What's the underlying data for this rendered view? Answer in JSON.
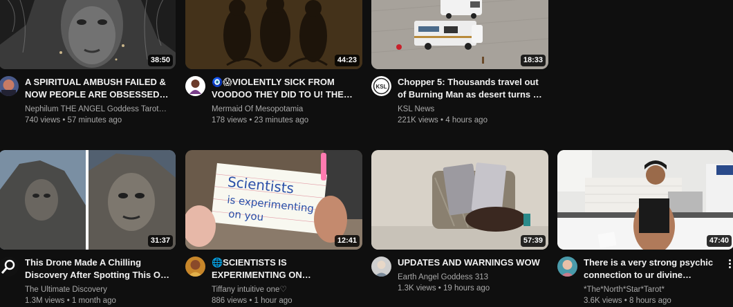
{
  "videos": [
    {
      "title": "A SPIRITUAL AMBUSH FAILED & NOW PEOPLE ARE OBSESSED…",
      "channel": "Nephilum THE ANGEL Goddess Tarot…",
      "stats": "740 views • 57 minutes ago",
      "duration": "38:50"
    },
    {
      "title": "🧿😱VIOLENTLY SICK FROM VOODOO THEY DID TO U! THE…",
      "channel": "Mermaid Of Mesopotamia",
      "stats": "178 views • 23 minutes ago",
      "duration": "44:23"
    },
    {
      "title": "Chopper 5: Thousands travel out of Burning Man as desert turns …",
      "channel": "KSL News",
      "stats": "221K views • 4 hours ago",
      "duration": "18:33",
      "avatar_text": "KSL"
    },
    {
      "title": "This Drone Made A Chilling Discovery After Spotting This O…",
      "channel": "The Ultimate Discovery",
      "stats": "1.3M views • 1 month ago",
      "duration": "31:37"
    },
    {
      "title": "🌐SCIENTISTS IS EXPERIMENTING ON…",
      "channel": "Tiffany intuitive one♡",
      "stats": "886 views • 1 hour ago",
      "duration": "12:41",
      "card_text_1": "Scientists",
      "card_text_2": "is experimenting",
      "card_text_3": "on you"
    },
    {
      "title": "UPDATES AND WARNINGS WOW",
      "channel": "Earth Angel Goddess 313",
      "stats": "1.3K views • 19 hours ago",
      "duration": "57:39"
    },
    {
      "title": "There is a very strong psychic connection to ur divine…",
      "channel": "*The*North*Star*Tarot*",
      "stats": "3.6K views • 8 hours ago",
      "duration": "47:40"
    }
  ],
  "colors": {
    "background": "#0f0f0f",
    "text_primary": "#f1f1f1",
    "text_secondary": "#aaaaaa"
  },
  "icons": {
    "more": "vertical-ellipsis-icon"
  }
}
